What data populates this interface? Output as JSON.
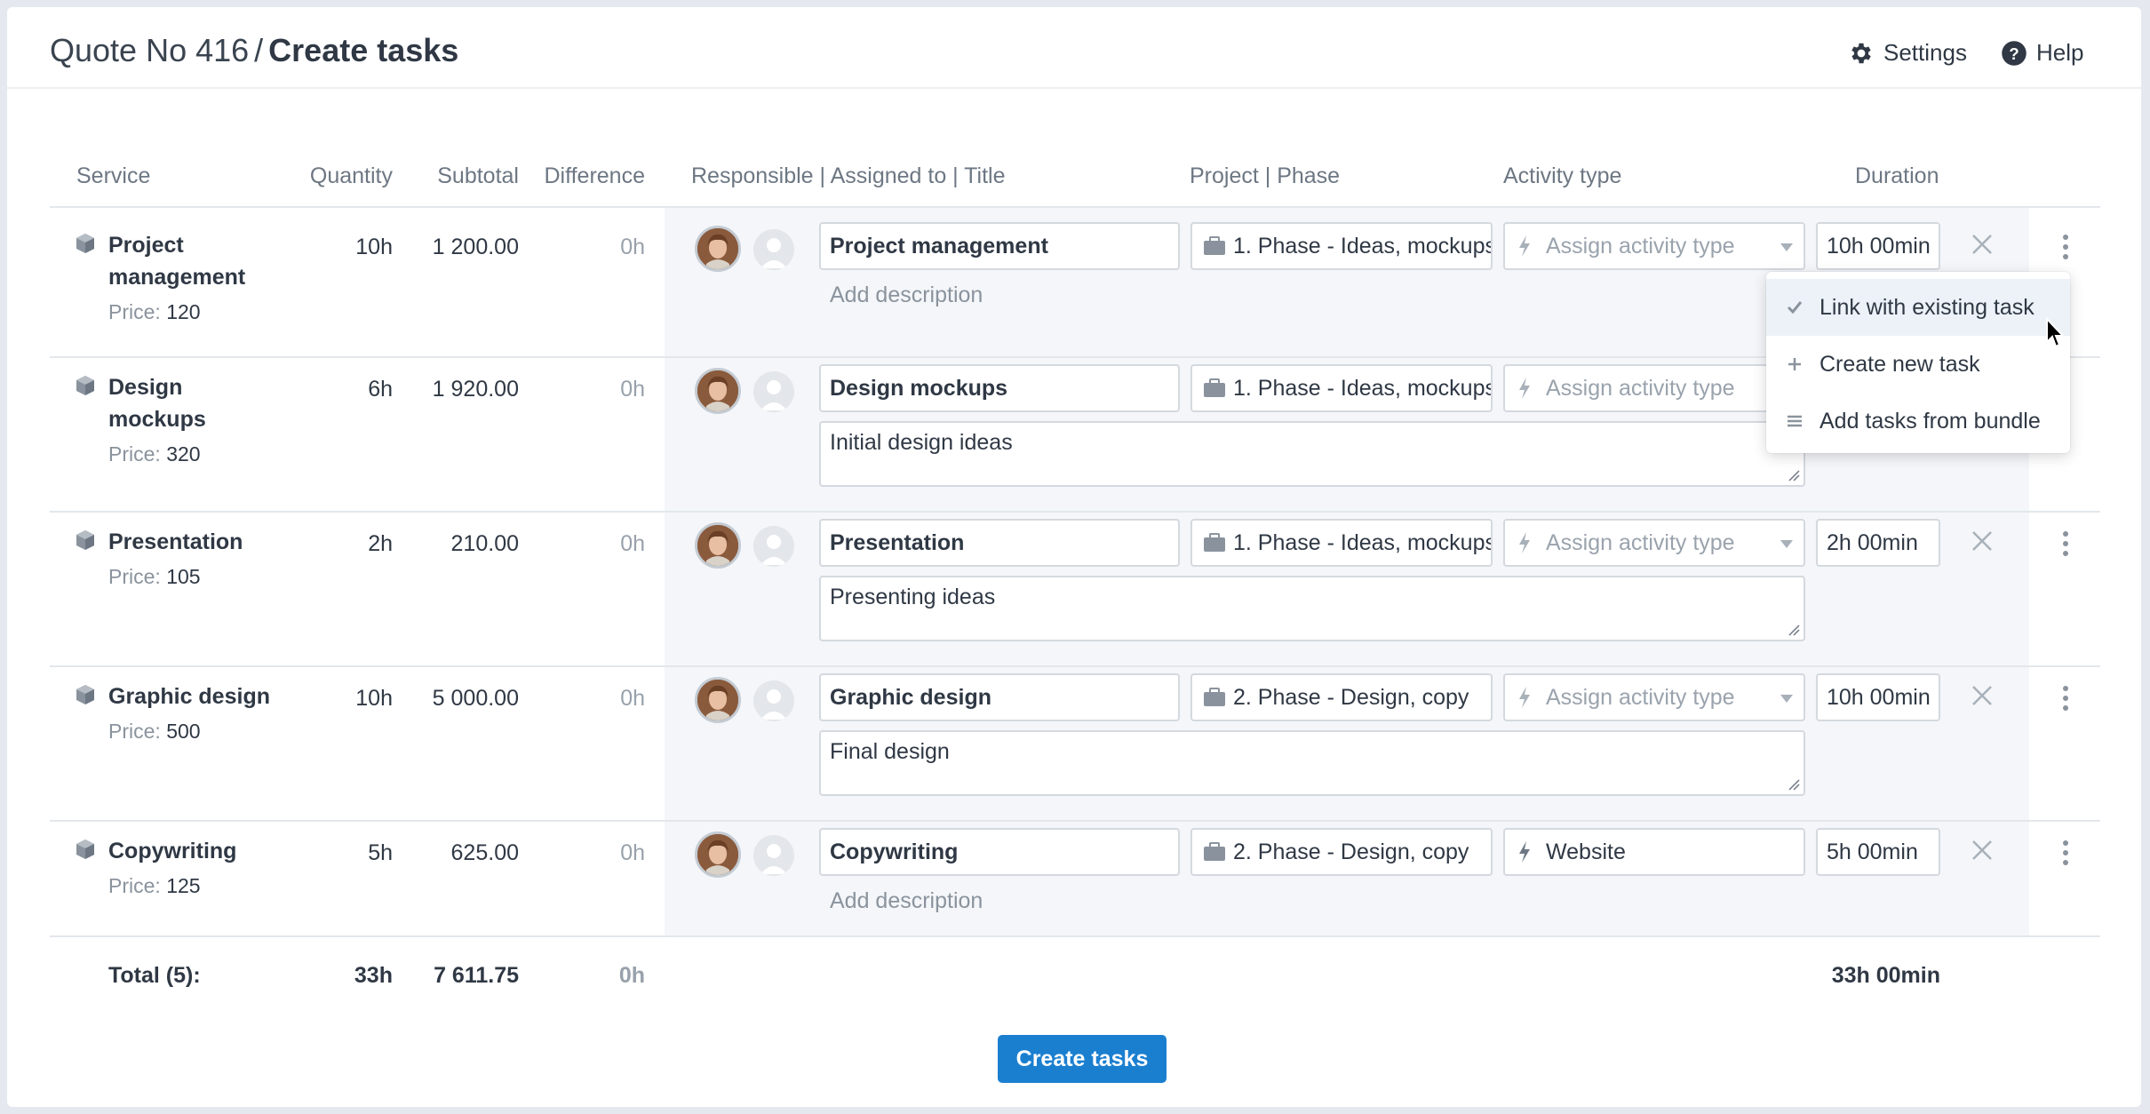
{
  "header": {
    "breadcrumb": "Quote No 416",
    "separator": "/",
    "title": "Create tasks",
    "settings_label": "Settings",
    "help_label": "Help"
  },
  "columns": {
    "service": "Service",
    "quantity": "Quantity",
    "subtotal": "Subtotal",
    "difference": "Difference",
    "responsible": "Responsible | Assigned to | Title",
    "project": "Project | Phase",
    "activity": "Activity type",
    "duration": "Duration"
  },
  "price_label": "Price:",
  "rows": [
    {
      "service_line1": "Project",
      "service_line2": "management",
      "price": "120",
      "quantity": "10h",
      "subtotal": "1 200.00",
      "difference": "0h",
      "task_title": "Project management",
      "project_phase": "1. Phase - Ideas, mockups",
      "activity": "Assign activity type",
      "duration": "10h 00min",
      "description": "Add description"
    },
    {
      "service_line1": "Design",
      "service_line2": "mockups",
      "price": "320",
      "quantity": "6h",
      "subtotal": "1 920.00",
      "difference": "0h",
      "task_title": "Design mockups",
      "project_phase": "1. Phase - Ideas, mockups",
      "activity": "Assign activity type",
      "description": "Initial design ideas"
    },
    {
      "service_line1": "Presentation",
      "price": "105",
      "quantity": "2h",
      "subtotal": "210.00",
      "difference": "0h",
      "task_title": "Presentation",
      "project_phase": "1. Phase - Ideas, mockups",
      "activity": "Assign activity type",
      "duration": "2h 00min",
      "description": "Presenting ideas"
    },
    {
      "service_line1": "Graphic design",
      "price": "500",
      "quantity": "10h",
      "subtotal": "5 000.00",
      "difference": "0h",
      "task_title": "Graphic design",
      "project_phase": "2. Phase - Design, copy",
      "activity": "Assign activity type",
      "duration": "10h 00min",
      "description": "Final design"
    },
    {
      "service_line1": "Copywriting",
      "price": "125",
      "quantity": "5h",
      "subtotal": "625.00",
      "difference": "0h",
      "task_title": "Copywriting",
      "project_phase": "2. Phase - Design, copy",
      "activity": "Website",
      "duration": "5h 00min",
      "description": "Add description"
    }
  ],
  "totals": {
    "label": "Total (5):",
    "quantity": "33h",
    "subtotal": "7 611.75",
    "difference": "0h",
    "duration": "33h 00min"
  },
  "menu": {
    "items": [
      {
        "label": "Link with existing task",
        "icon": "check-icon"
      },
      {
        "label": "Create new task",
        "icon": "plus-icon"
      },
      {
        "label": "Add tasks from bundle",
        "icon": "list-icon"
      }
    ]
  },
  "create_button": "Create tasks",
  "colors": {
    "primary": "#1b7fd0",
    "panel_bg": "#f4f6f9",
    "muted_text": "#8a939d"
  }
}
